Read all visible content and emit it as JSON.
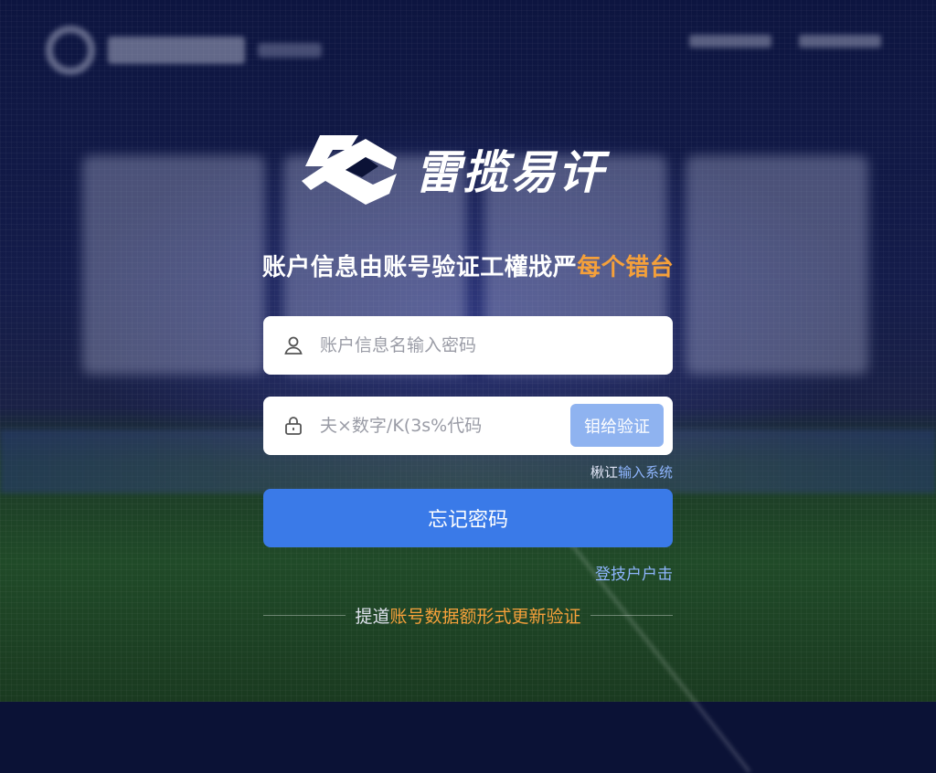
{
  "brand": {
    "name": "雷揽易讦",
    "icon": "brand-logo-icon"
  },
  "headline": {
    "main": "账户信息由账号验证工權戕严",
    "accent": "每个错台"
  },
  "form": {
    "username": {
      "placeholder": "账户信息名输入密码",
      "icon": "user-icon"
    },
    "code": {
      "placeholder": "夫×数字/K(3s%代码",
      "icon": "lock-icon",
      "verify_label": "钼给验证"
    },
    "hint": {
      "prefix": "楸讧",
      "link": "输入系统"
    },
    "submit_label": "忘记密码",
    "register_label": "登技户户击"
  },
  "footer": {
    "prefix": "提道",
    "accent": "账号数据额形式更新验证"
  },
  "colors": {
    "accent": "#f5a03a",
    "primary": "#3a7ae8",
    "link": "#8fb6ff"
  }
}
